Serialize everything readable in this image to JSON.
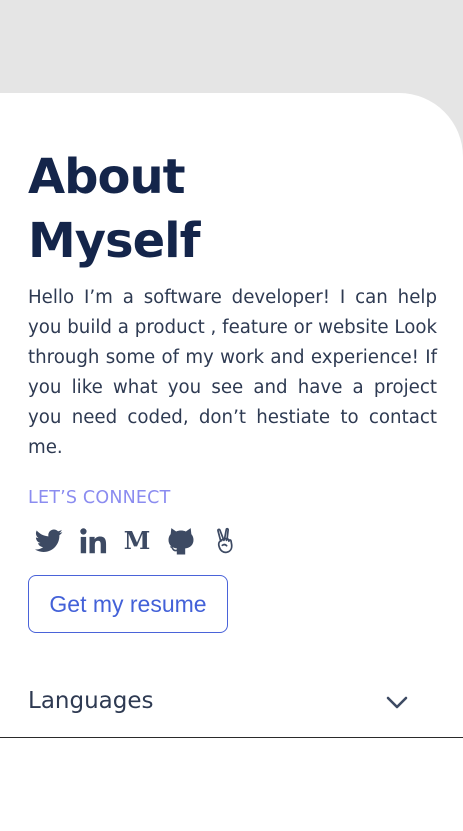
{
  "about": {
    "title": "About\nMyself",
    "bio": "Hello I’m a software developer! I can help you build a product , feature or website Look through some of my work and experience! If you like what you see and have a project you need coded, don’t hestiate to contact me.",
    "connect_label": "LET’S CONNECT",
    "socials": [
      {
        "name": "twitter",
        "icon": "twitter-icon"
      },
      {
        "name": "linkedin",
        "icon": "linkedin-icon"
      },
      {
        "name": "medium",
        "icon": "medium-icon"
      },
      {
        "name": "github",
        "icon": "github-icon"
      },
      {
        "name": "peace",
        "icon": "peace-hand-icon"
      }
    ],
    "resume_button": "Get my resume"
  },
  "accordion": {
    "languages_label": "Languages",
    "icon": "chevron-down-icon"
  },
  "colors": {
    "background": "#e5e5e5",
    "card": "#ffffff",
    "heading": "#14254a",
    "body_text": "#2e3a52",
    "accent_label": "#8b8cf0",
    "button_accent": "#4361d8",
    "icon": "#3d4a63"
  }
}
